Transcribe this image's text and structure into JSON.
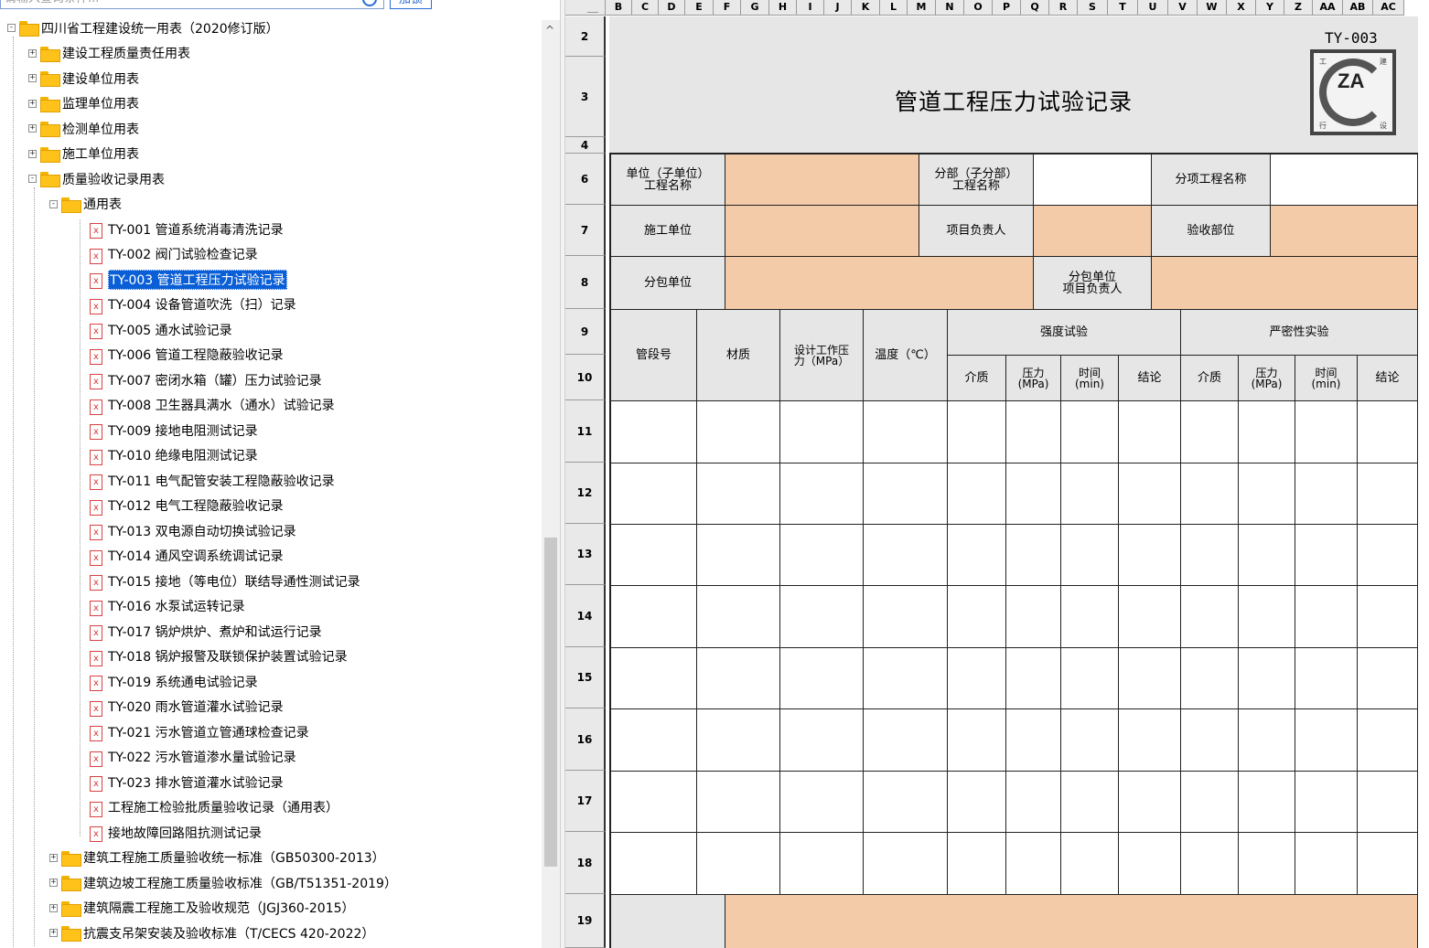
{
  "search": {
    "placeholder": "请输入查询条件...",
    "add_label": "加锁"
  },
  "tree": {
    "root": "四川省工程建设统一用表（2020修订版）",
    "level1": [
      "建设工程质量责任用表",
      "建设单位用表",
      "监理单位用表",
      "检测单位用表",
      "施工单位用表",
      "质量验收记录用表"
    ],
    "group": "通用表",
    "docs": [
      "TY-001 管道系统消毒清洗记录",
      "TY-002 阀门试验检查记录",
      "TY-003 管道工程压力试验记录",
      "TY-004 设备管道吹洗（扫）记录",
      "TY-005 通水试验记录",
      "TY-006 管道工程隐蔽验收记录",
      "TY-007 密闭水箱（罐）压力试验记录",
      "TY-008 卫生器具满水（通水）试验记录",
      "TY-009 接地电阻测试记录",
      "TY-010 绝缘电阻测试记录",
      "TY-011 电气配管安装工程隐蔽验收记录",
      "TY-012 电气工程隐蔽验收记录",
      "TY-013 双电源自动切换试验记录",
      "TY-014 通风空调系统调试记录",
      "TY-015 接地（等电位）联结导通性测试记录",
      "TY-016 水泵试运转记录",
      "TY-017 锅炉烘炉、煮炉和试运行记录",
      "TY-018 锅炉报警及联锁保护装置试验记录",
      "TY-019 系统通电试验记录",
      "TY-020 雨水管道灌水试验记录",
      "TY-021 污水管道立管通球检查记录",
      "TY-022 污水管道渗水量试验记录",
      "TY-023 排水管道灌水试验记录",
      "工程施工检验批质量验收记录（通用表）",
      "接地故障回路阻抗测试记录"
    ],
    "selected_index": 2,
    "bottom": [
      "建筑工程施工质量验收统一标准（GB50300-2013）",
      "建筑边坡工程施工质量验收标准（GB/T51351-2019）",
      "建筑隔震工程施工及验收规范（JGJ360-2015）",
      "抗震支吊架安装及验收标准（T/CECS 420-2022）"
    ]
  },
  "sheet": {
    "columns": [
      "B",
      "C",
      "D",
      "E",
      "F",
      "G",
      "H",
      "I",
      "J",
      "K",
      "L",
      "M",
      "N",
      "O",
      "P",
      "Q",
      "R",
      "S",
      "T",
      "U",
      "V",
      "W",
      "X",
      "Y",
      "Z",
      "AA",
      "AB",
      "AC"
    ],
    "rows": [
      "2",
      "3",
      "4",
      "6",
      "7",
      "8",
      "9",
      "10",
      "11",
      "12",
      "13",
      "14",
      "15",
      "16",
      "17",
      "18",
      "19"
    ],
    "form_code": "TY-003",
    "form_title": "管道工程压力试验记录",
    "logo_text": "ZA",
    "logo_chars": [
      "工",
      "建",
      "行",
      "设"
    ],
    "labels": {
      "unit_name": "单位（子单位）\n工程名称",
      "sub_name": "分部（子分部）\n工程名称",
      "item_name": "分项工程名称",
      "construction_unit": "施工单位",
      "project_leader": "项目负责人",
      "acceptance_part": "验收部位",
      "subcontractor": "分包单位",
      "sub_leader": "分包单位\n项目负责人"
    },
    "table_head": {
      "pipe_no": "管段号",
      "material": "材质",
      "design_pressure": "设计工作压\n力（MPa）",
      "temperature": "温度（℃）",
      "strength": "强度试验",
      "tightness": "严密性实验",
      "medium": "介质",
      "pressure": "压力\n(MPa)",
      "time": "时间\n(min)",
      "conclusion": "结论"
    }
  }
}
